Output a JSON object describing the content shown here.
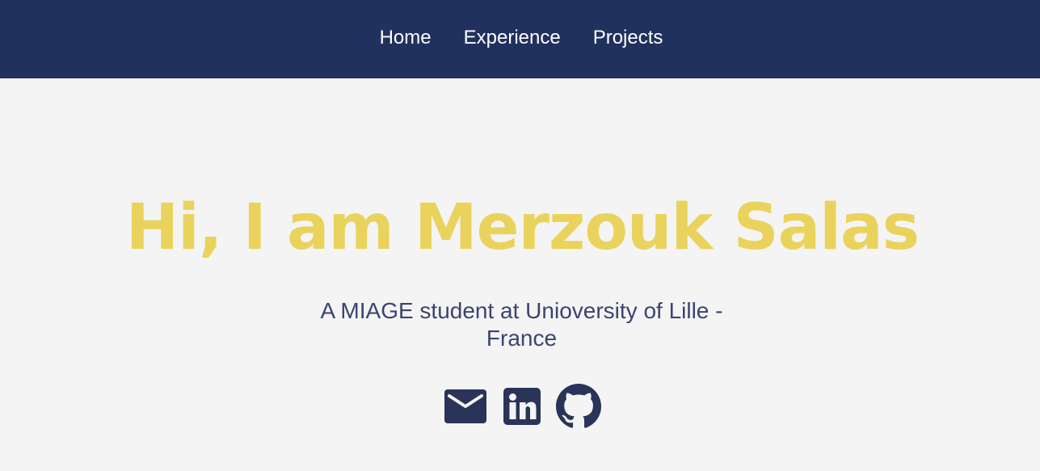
{
  "nav": {
    "items": [
      {
        "label": "Home"
      },
      {
        "label": "Experience"
      },
      {
        "label": "Projects"
      }
    ]
  },
  "hero": {
    "title": "Hi, I am Merzouk Salas",
    "subtitle": "A MIAGE student at Unioversity of Lille - France"
  },
  "socials": [
    {
      "icon": "mail-icon"
    },
    {
      "icon": "linkedin-icon"
    },
    {
      "icon": "github-icon"
    }
  ],
  "colors": {
    "navbar_bg": "#21315e",
    "page_bg": "#f4f4f4",
    "title": "#e9d35c",
    "subtitle": "#3a4470",
    "icons": "#2a3459"
  }
}
